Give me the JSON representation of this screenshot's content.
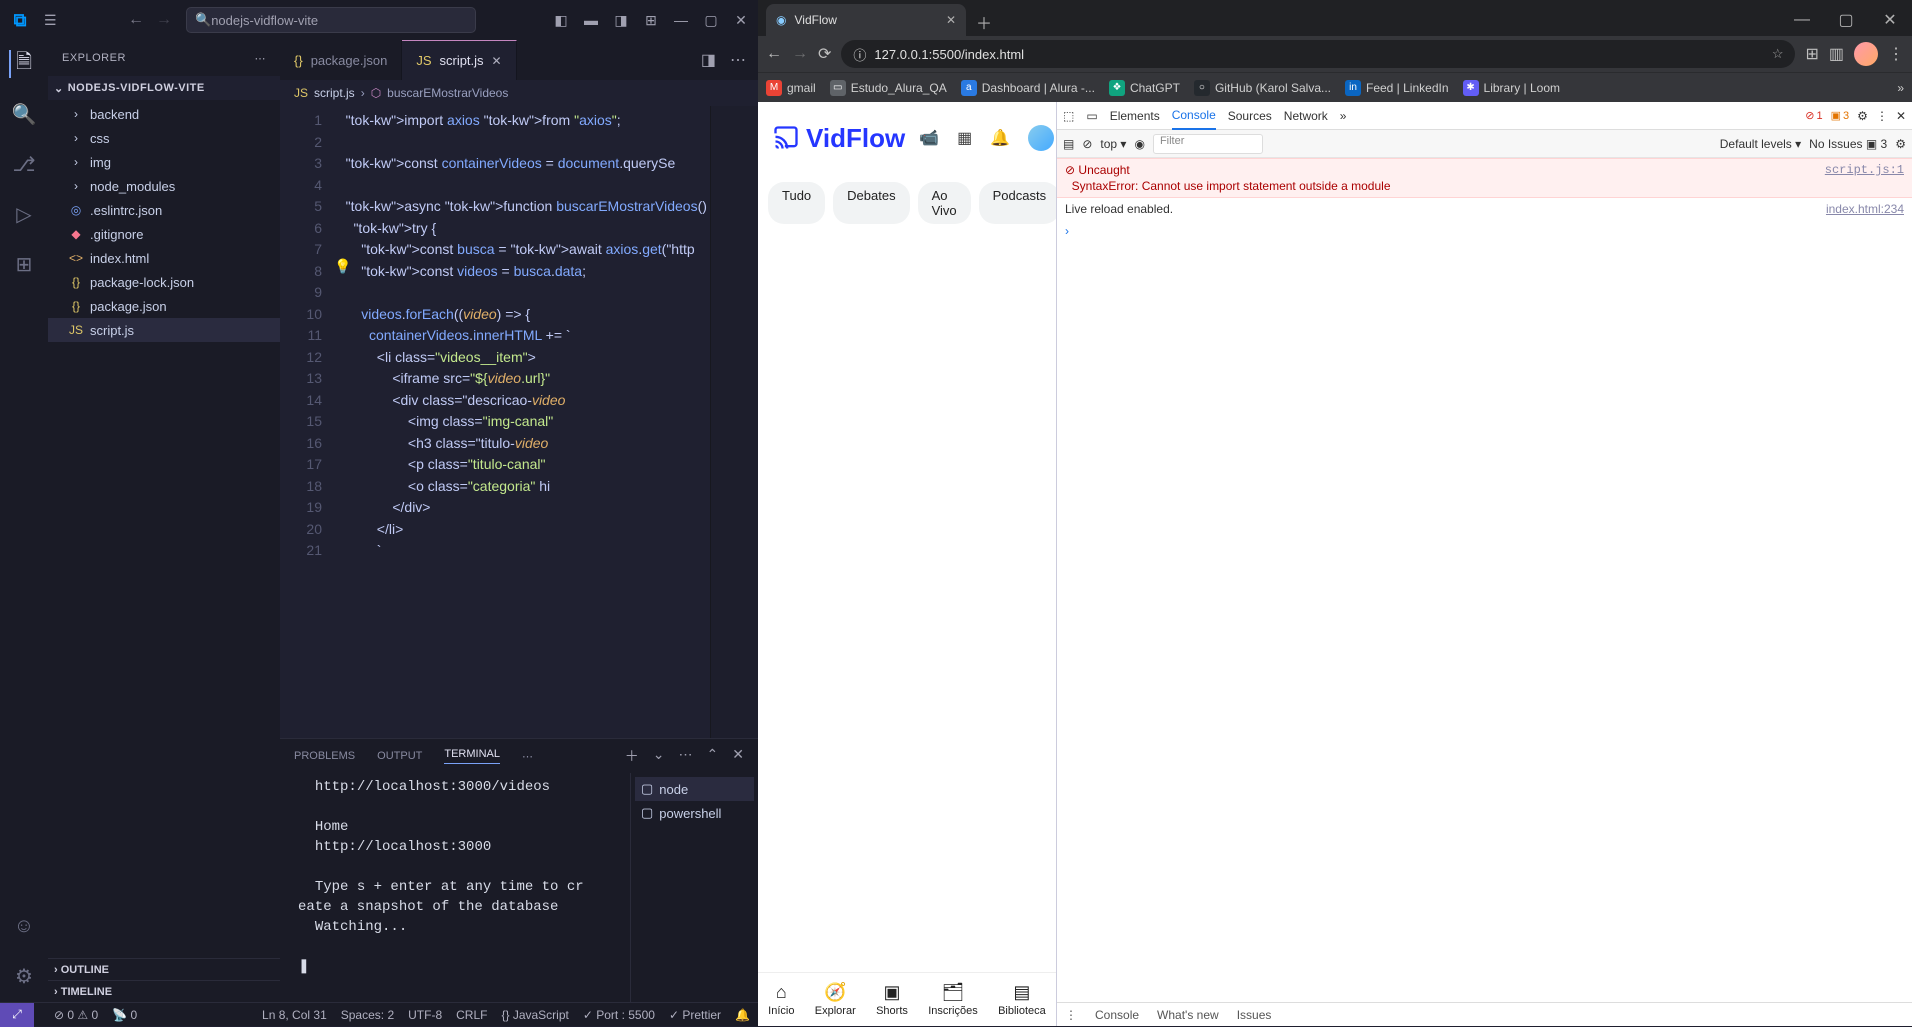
{
  "vscode": {
    "search_text": "nodejs-vidflow-vite",
    "explorer_label": "EXPLORER",
    "project_name": "NODEJS-VIDFLOW-VITE",
    "tree": {
      "folders": [
        "backend",
        "css",
        "img",
        "node_modules"
      ],
      "files": [
        {
          "name": ".eslintrc.json",
          "icon": "◎",
          "cls": "fc-blue"
        },
        {
          "name": ".gitignore",
          "icon": "◆",
          "cls": "fc-red"
        },
        {
          "name": "index.html",
          "icon": "<>",
          "cls": "fc-orange"
        },
        {
          "name": "package-lock.json",
          "icon": "{}",
          "cls": "fc-yellow"
        },
        {
          "name": "package.json",
          "icon": "{}",
          "cls": "fc-yellow"
        },
        {
          "name": "script.js",
          "icon": "JS",
          "cls": "fc-yellow",
          "sel": true
        }
      ]
    },
    "outline_label": "OUTLINE",
    "timeline_label": "TIMELINE",
    "tabs": [
      {
        "name": "package.json",
        "icon": "{}",
        "active": false
      },
      {
        "name": "script.js",
        "icon": "JS",
        "active": true
      }
    ],
    "breadcrumb": {
      "file": "script.js",
      "symbol": "buscarEMostrarVideos"
    },
    "code_lines": [
      "import axios from \"axios\";",
      "",
      "const containerVideos = document.querySe",
      "",
      "async function buscarEMostrarVideos() {",
      "  try {",
      "    const busca = await axios.get(\"http",
      "    const videos = busca.data;",
      "",
      "    videos.forEach((video) => {",
      "      containerVideos.innerHTML += `",
      "        <li class=\"videos__item\">",
      "            <iframe src=\"${video.url}\" ",
      "            <div class=\"descricao-video",
      "                <img class=\"img-canal\" ",
      "                <h3 class=\"titulo-video",
      "                <p class=\"titulo-canal\"",
      "                <o class=\"categoria\" hi",
      "            </div>",
      "        </li>",
      "        `"
    ],
    "panel": {
      "tabs": [
        "PROBLEMS",
        "OUTPUT",
        "TERMINAL"
      ],
      "active": "TERMINAL",
      "terminal_text": "  http://localhost:3000/videos\n\n  Home\n  http://localhost:3000\n\n  Type s + enter at any time to cr\neate a snapshot of the database\n  Watching...\n\n❚",
      "term_list": [
        "node",
        "powershell"
      ]
    },
    "status": {
      "errors": "0",
      "warnings": "0",
      "port_fwd": "0",
      "cursor": "Ln 8, Col 31",
      "spaces": "Spaces: 2",
      "enc": "UTF-8",
      "eol": "CRLF",
      "lang": "JavaScript",
      "port": "Port : 5500",
      "prettier": "Prettier"
    }
  },
  "chrome": {
    "tab_title": "VidFlow",
    "url": "127.0.0.1:5500/index.html",
    "bookmarks": [
      {
        "label": "gmail",
        "icon": "M",
        "bg": "#ea4335"
      },
      {
        "label": "Estudo_Alura_QA",
        "icon": "▭",
        "bg": "#5f6368"
      },
      {
        "label": "Dashboard | Alura -...",
        "icon": "a",
        "bg": "#2a7ae2"
      },
      {
        "label": "ChatGPT",
        "icon": "❖",
        "bg": "#10a37f"
      },
      {
        "label": "GitHub (Karol Salva...",
        "icon": "○",
        "bg": "#24292e"
      },
      {
        "label": "Feed | LinkedIn",
        "icon": "in",
        "bg": "#0a66c2"
      },
      {
        "label": "Library | Loom",
        "icon": "✱",
        "bg": "#625df5"
      }
    ],
    "page": {
      "logo_text": "VidFlow",
      "chips": [
        "Tudo",
        "Debates",
        "Ao Vivo",
        "Podcasts"
      ],
      "footer": [
        {
          "icon": "⌂",
          "label": "Início"
        },
        {
          "icon": "🧭",
          "label": "Explorar"
        },
        {
          "icon": "▣",
          "label": "Shorts"
        },
        {
          "icon": "🗂",
          "label": "Inscrições"
        },
        {
          "icon": "▤",
          "label": "Biblioteca"
        }
      ]
    },
    "devtools": {
      "tabs": [
        "Elements",
        "Console",
        "Sources",
        "Network"
      ],
      "active": "Console",
      "error_count": "1",
      "warn_count": "3",
      "context": "top",
      "levels": "Default levels",
      "issues": "No Issues",
      "issues_badge": "3",
      "filter_placeholder": "Filter",
      "messages": [
        {
          "type": "error",
          "head": "Uncaught",
          "body": "SyntaxError: Cannot use import statement outside a module",
          "src": "script.js:1"
        },
        {
          "type": "log",
          "body": "Live reload enabled.",
          "src": "index.html:234"
        }
      ],
      "footer": [
        "Console",
        "What's new",
        "Issues"
      ]
    }
  }
}
